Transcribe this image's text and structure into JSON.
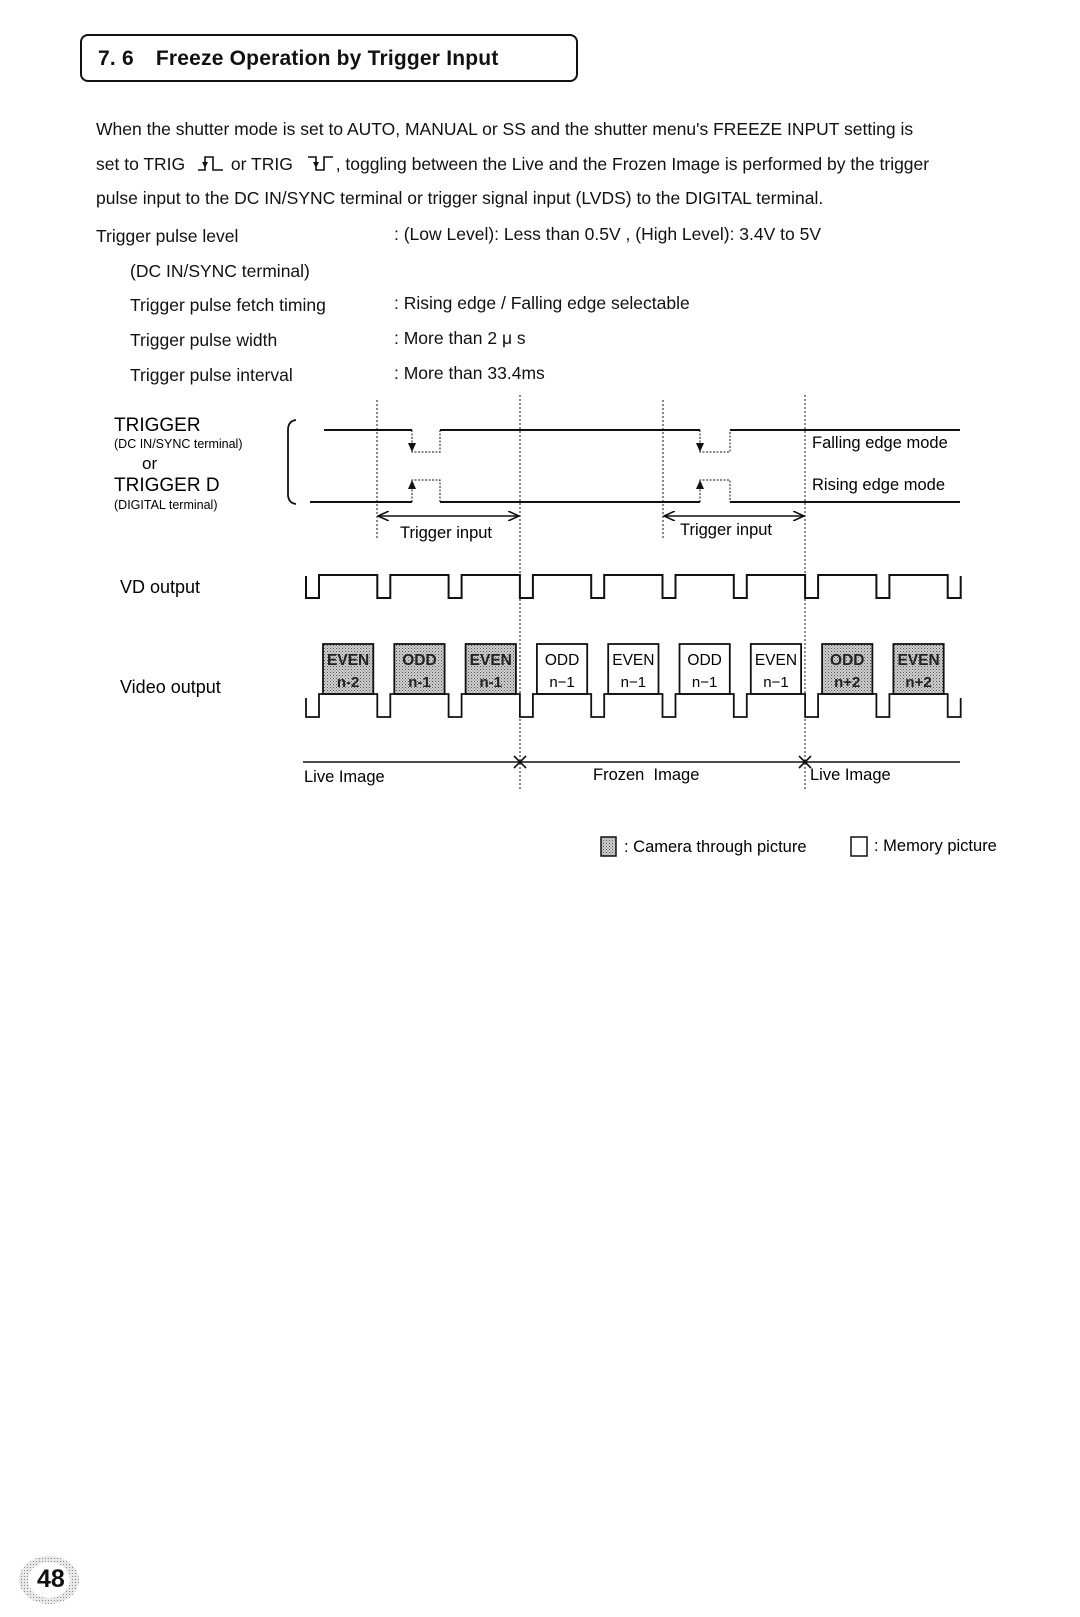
{
  "section": {
    "number": "7. 6",
    "title": "Freeze Operation by Trigger Input"
  },
  "intro": {
    "line1": "When the shutter mode is set to AUTO, MANUAL or SS and the shutter menu's FREEZE INPUT setting is",
    "line2_a": "set to TRIG",
    "line2_sym1": "rising-trigger-symbol",
    "line2_b": "or TRIG",
    "line2_sym2": "falling-trigger-symbol",
    "line2_c": ", toggling between the Live and the Frozen Image is performed by the trigger",
    "line3": "pulse input to the DC IN/SYNC terminal or trigger signal input (LVDS) to the DIGITAL terminal."
  },
  "specs": [
    {
      "label": "Trigger pulse level",
      "value": ":  (Low Level): Less than 0.5V , (High Level): 3.4V to 5V"
    },
    {
      "label": "(DC IN/SYNC terminal)",
      "value": ""
    },
    {
      "label": "Trigger pulse fetch timing",
      "value": ":  Rising edge / Falling edge    selectable"
    },
    {
      "label": "Trigger pulse width",
      "value": ":  More than 2 μ s"
    },
    {
      "label": "Trigger pulse interval",
      "value": ":  More than 33.4ms"
    }
  ],
  "diagram": {
    "trigger_label": "TRIGGER",
    "trigger_sub": "(DC IN/SYNC terminal)",
    "or_label": "or",
    "trigger_d_label": "TRIGGER D",
    "trigger_d_sub": "(DIGITAL terminal)",
    "falling_mode": "Falling edge mode",
    "rising_mode": "Rising edge mode",
    "trigger_input_1": "Trigger input",
    "trigger_input_2": "Trigger input",
    "vd_label": "VD output",
    "video_label": "Video output",
    "fields": [
      {
        "field": "EVEN",
        "index": "n-2",
        "type": "camera"
      },
      {
        "field": "ODD",
        "index": "n-1",
        "type": "camera"
      },
      {
        "field": "EVEN",
        "index": "n-1",
        "type": "camera"
      },
      {
        "field": "ODD",
        "index": "n−1",
        "type": "memory"
      },
      {
        "field": "EVEN",
        "index": "n−1",
        "type": "memory"
      },
      {
        "field": "ODD",
        "index": "n−1",
        "type": "memory"
      },
      {
        "field": "EVEN",
        "index": "n−1",
        "type": "memory"
      },
      {
        "field": "ODD",
        "index": "n+2",
        "type": "camera"
      },
      {
        "field": "EVEN",
        "index": "n+2",
        "type": "camera"
      }
    ],
    "phases": {
      "live_1": "Live Image",
      "frozen": "Frozen  Image",
      "live_2": "Live Image"
    }
  },
  "legend": {
    "camera": ": Camera through picture",
    "memory": ": Memory picture"
  },
  "page_number": "48"
}
